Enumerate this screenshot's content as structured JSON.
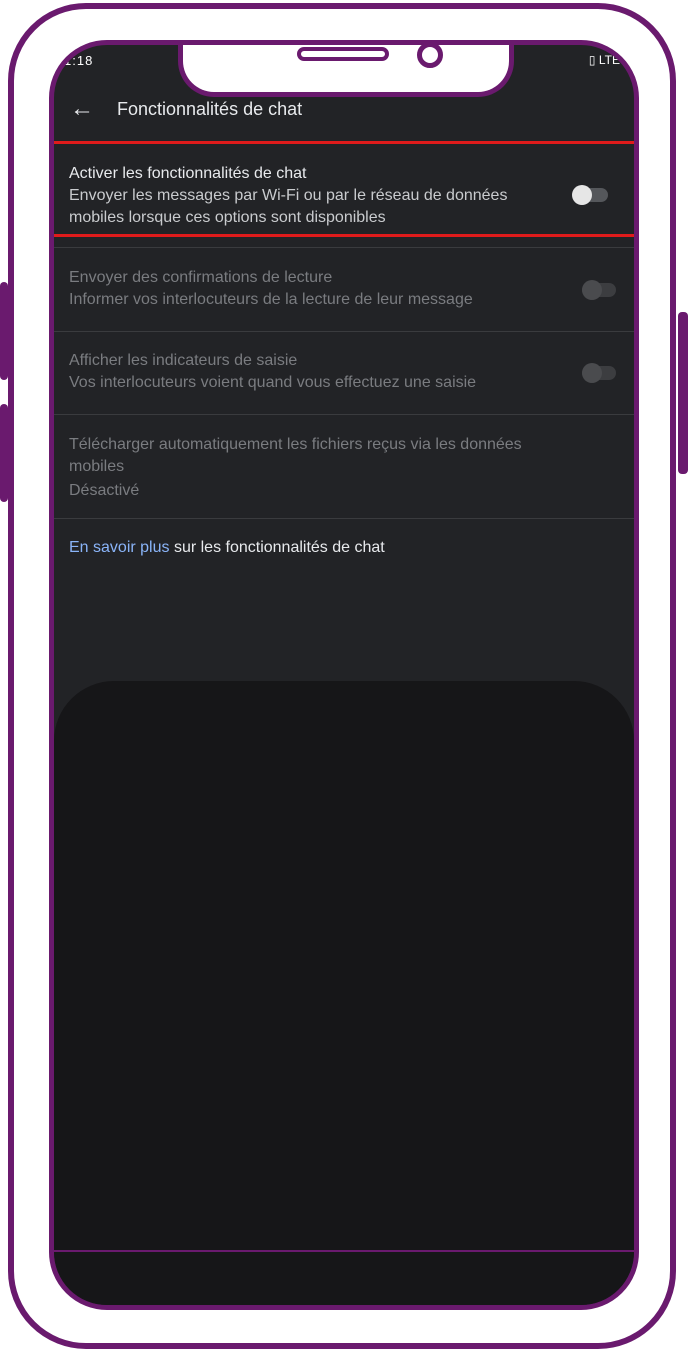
{
  "status_bar": {
    "time": "1:18",
    "network": "LTE"
  },
  "app_bar": {
    "title": "Fonctionnalités de chat"
  },
  "settings": [
    {
      "title": "Activer les fonctionnalités de chat",
      "desc_line1": "Envoyer les messages par Wi-Fi ou par le réseau de données",
      "desc_line2": "mobiles lorsque ces options sont disponibles",
      "enabled": true,
      "toggle_on": false
    },
    {
      "title": "Envoyer des confirmations de lecture",
      "desc_line1": "Informer vos interlocuteurs de la lecture de leur message",
      "enabled": false,
      "toggle_on": false
    },
    {
      "title": "Afficher les indicateurs de saisie",
      "desc_line1": "Vos interlocuteurs voient quand vous effectuez une saisie",
      "enabled": false,
      "toggle_on": false
    },
    {
      "title_line1": "Télécharger automatiquement les fichiers reçus via les données",
      "title_line2": "mobiles",
      "value": "Désactivé",
      "enabled": false
    }
  ],
  "learn_more": {
    "link": "En savoir plus",
    "rest": " sur les fonctionnalités de chat"
  },
  "colors": {
    "frame": "#6a1a6e",
    "highlight": "#e01b1b",
    "link": "#8ab4f8",
    "background": "#222326"
  }
}
